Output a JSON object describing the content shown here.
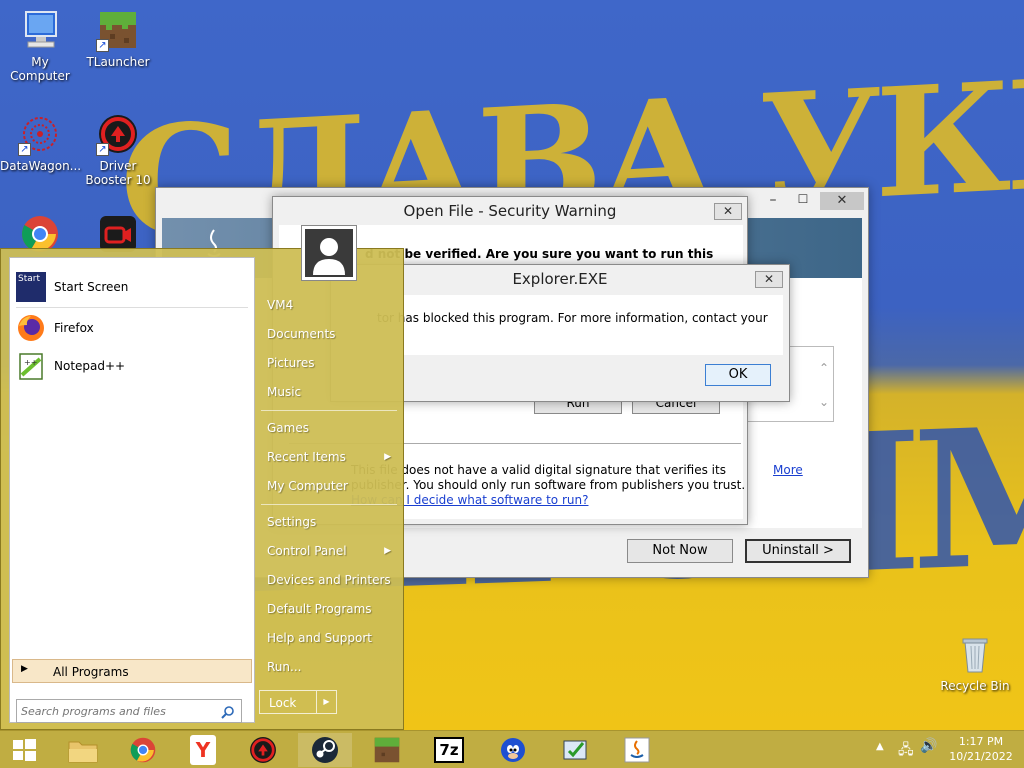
{
  "desktop_icons": [
    {
      "label": "My Computer"
    },
    {
      "label": "TLauncher"
    },
    {
      "label": "DataWagon..."
    },
    {
      "label": "Driver Booster 10"
    },
    {
      "label": "Recycle Bin"
    }
  ],
  "wallpaper": {
    "line1": "СЛАВА УКРАЇНІ",
    "line2": "ГЕРОЯМ СЛАВА"
  },
  "installer_window": {
    "not_now_label": "Not Now",
    "uninstall_label": "Uninstall >",
    "link_more": "More"
  },
  "security_warning": {
    "title": "Open File - Security Warning",
    "question": "d not be verified.  Are you sure you want to run this",
    "run_label": "Run",
    "cancel_label": "Cancel",
    "sig_line1": "This file does not have a valid digital signature that verifies its",
    "sig_line2": "publisher. You should only run software from publishers you trust.",
    "sig_link": "How can I decide what software to run?"
  },
  "explorer_dialog": {
    "title": "Explorer.EXE",
    "message": "tor has blocked this program. For more information, contact your",
    "ok_label": "OK"
  },
  "start_menu": {
    "pinned": [
      {
        "label": "Start Screen",
        "icon_text": "Start"
      },
      {
        "label": "Firefox"
      },
      {
        "label": "Notepad++"
      }
    ],
    "all_programs_label": "All Programs",
    "search_placeholder": "Search programs and files",
    "places": [
      {
        "label": "VM4"
      },
      {
        "label": "Documents"
      },
      {
        "label": "Pictures"
      },
      {
        "label": "Music"
      },
      {
        "label": "Games"
      },
      {
        "label": "Recent Items"
      },
      {
        "label": "My Computer"
      },
      {
        "label": "Settings"
      },
      {
        "label": "Control Panel"
      },
      {
        "label": "Devices and Printers"
      },
      {
        "label": "Default Programs"
      },
      {
        "label": "Help and Support"
      },
      {
        "label": "Run..."
      }
    ],
    "lock_label": "Lock"
  },
  "taskbar": {
    "time": "1:17 PM",
    "date": "10/21/2022",
    "zip_label": "7z",
    "yandex_label": "Y"
  },
  "colors": {
    "accent": "#1a3fd0",
    "taskbar": "#beaa3c",
    "start_menu": "#cebe54"
  }
}
